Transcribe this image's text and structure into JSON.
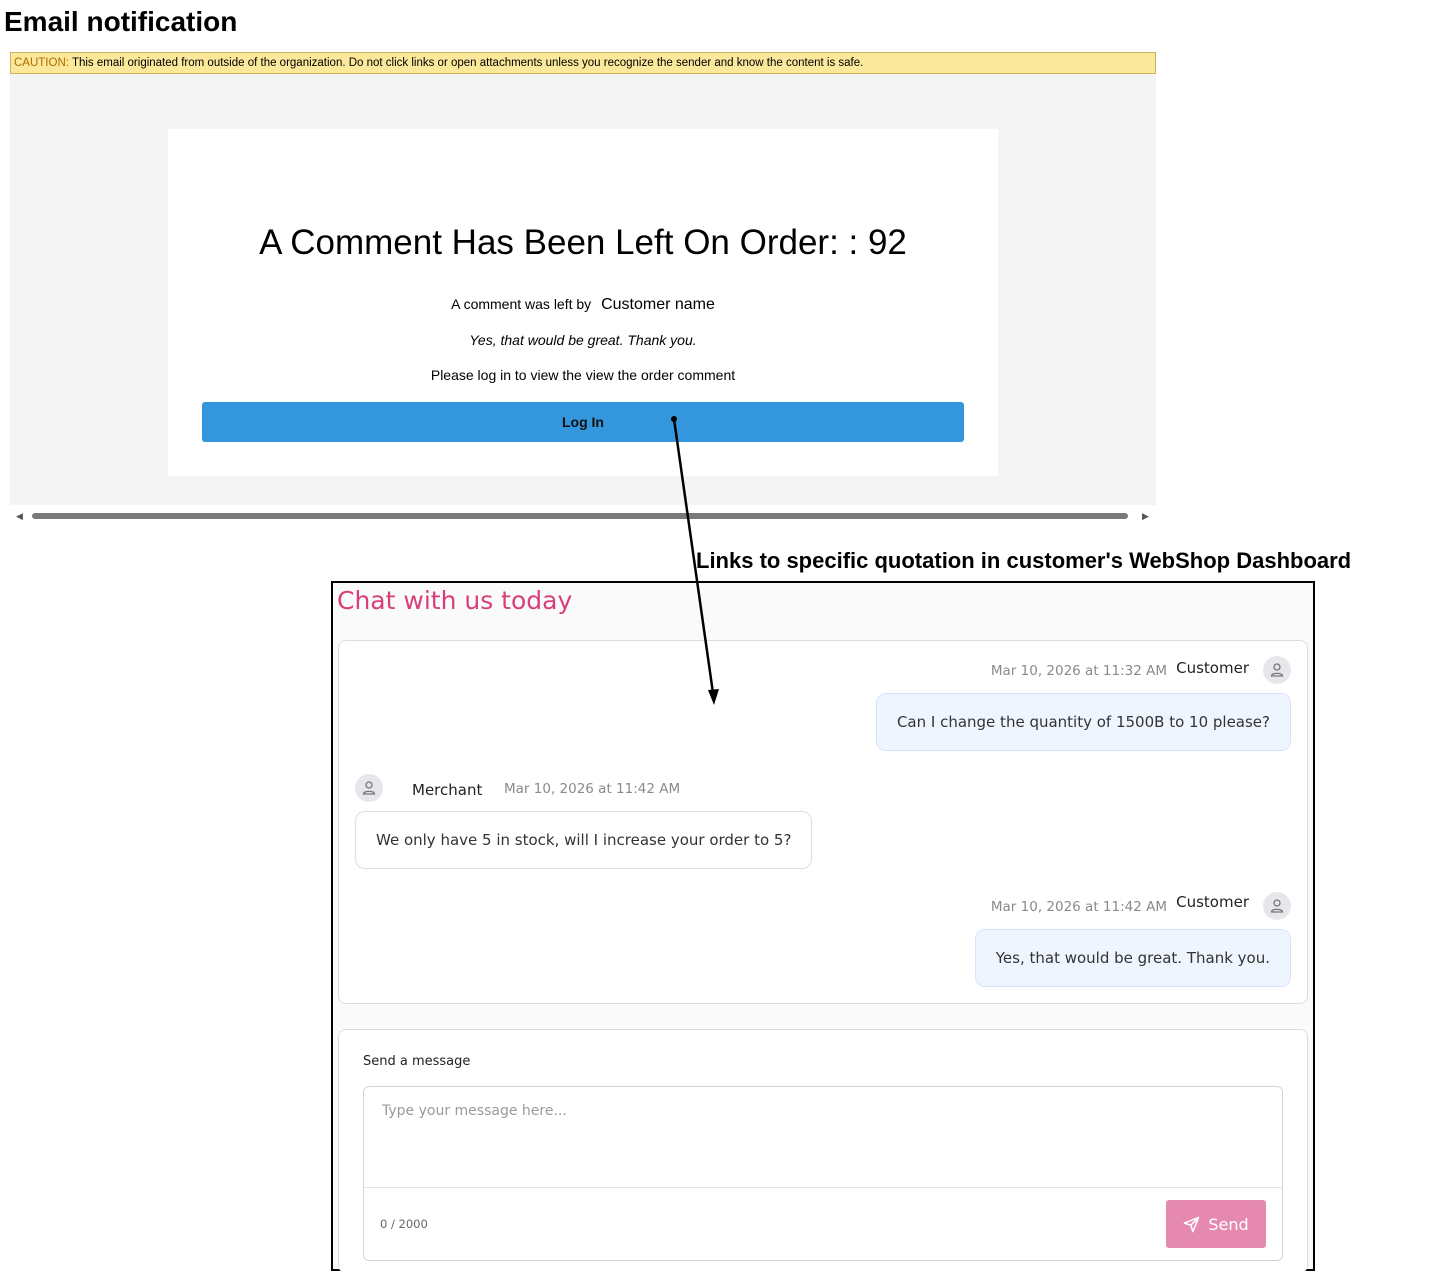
{
  "email": {
    "heading": "Email notification",
    "caution_label": "CAUTION:",
    "caution_text": " This email originated from outside of the organization. Do not click links or open attachments unless you recognize the sender and know the content is safe.",
    "title": "A Comment Has Been Left On Order: : 92",
    "comment_by_label": "A comment was left by",
    "comment_author": "Customer name",
    "comment_text": "Yes, that would be great. Thank you.",
    "login_prompt": "Please log in to view the view the order comment",
    "login_button": "Log In"
  },
  "annotation": {
    "text": "Links to specific quotation in customer's WebShop Dashboard"
  },
  "chat": {
    "title": "Chat with us today",
    "messages": [
      {
        "direction": "outgoing",
        "author": "Customer",
        "timestamp": "Mar 10, 2026 at 11:32 AM",
        "text": "Can I change the quantity of 1500B to 10 please?"
      },
      {
        "direction": "incoming",
        "author": "Merchant",
        "timestamp": "Mar 10, 2026 at 11:42 AM",
        "text": "We only have 5 in stock, will I increase your order to 5?"
      },
      {
        "direction": "outgoing",
        "author": "Customer",
        "timestamp": "Mar 10, 2026 at 11:42 AM",
        "text": "Yes, that would be great. Thank you."
      }
    ],
    "compose": {
      "label": "Send a message",
      "placeholder": "Type your message here...",
      "char_count": "0 / 2000",
      "send_label": "Send"
    }
  },
  "colors": {
    "caution_bg": "#fbe89a",
    "login_button": "#3496dc",
    "chat_title": "#d83f7a",
    "outgoing_bubble": "#eff5ff",
    "send_button": "#e689b0"
  }
}
